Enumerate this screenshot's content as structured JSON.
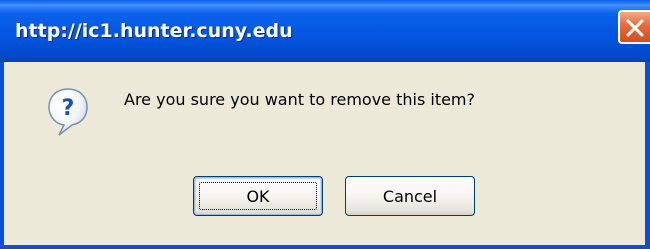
{
  "dialog": {
    "title": "http://ic1.hunter.cuny.edu",
    "message": "Are you sure you want to remove this item?",
    "icon": "question-icon",
    "close_icon": "close-icon",
    "buttons": {
      "ok_label": "OK",
      "cancel_label": "Cancel"
    },
    "colors": {
      "titlebar": "#0554e0",
      "close_button": "#e0582a",
      "background": "#ece9d8"
    }
  }
}
